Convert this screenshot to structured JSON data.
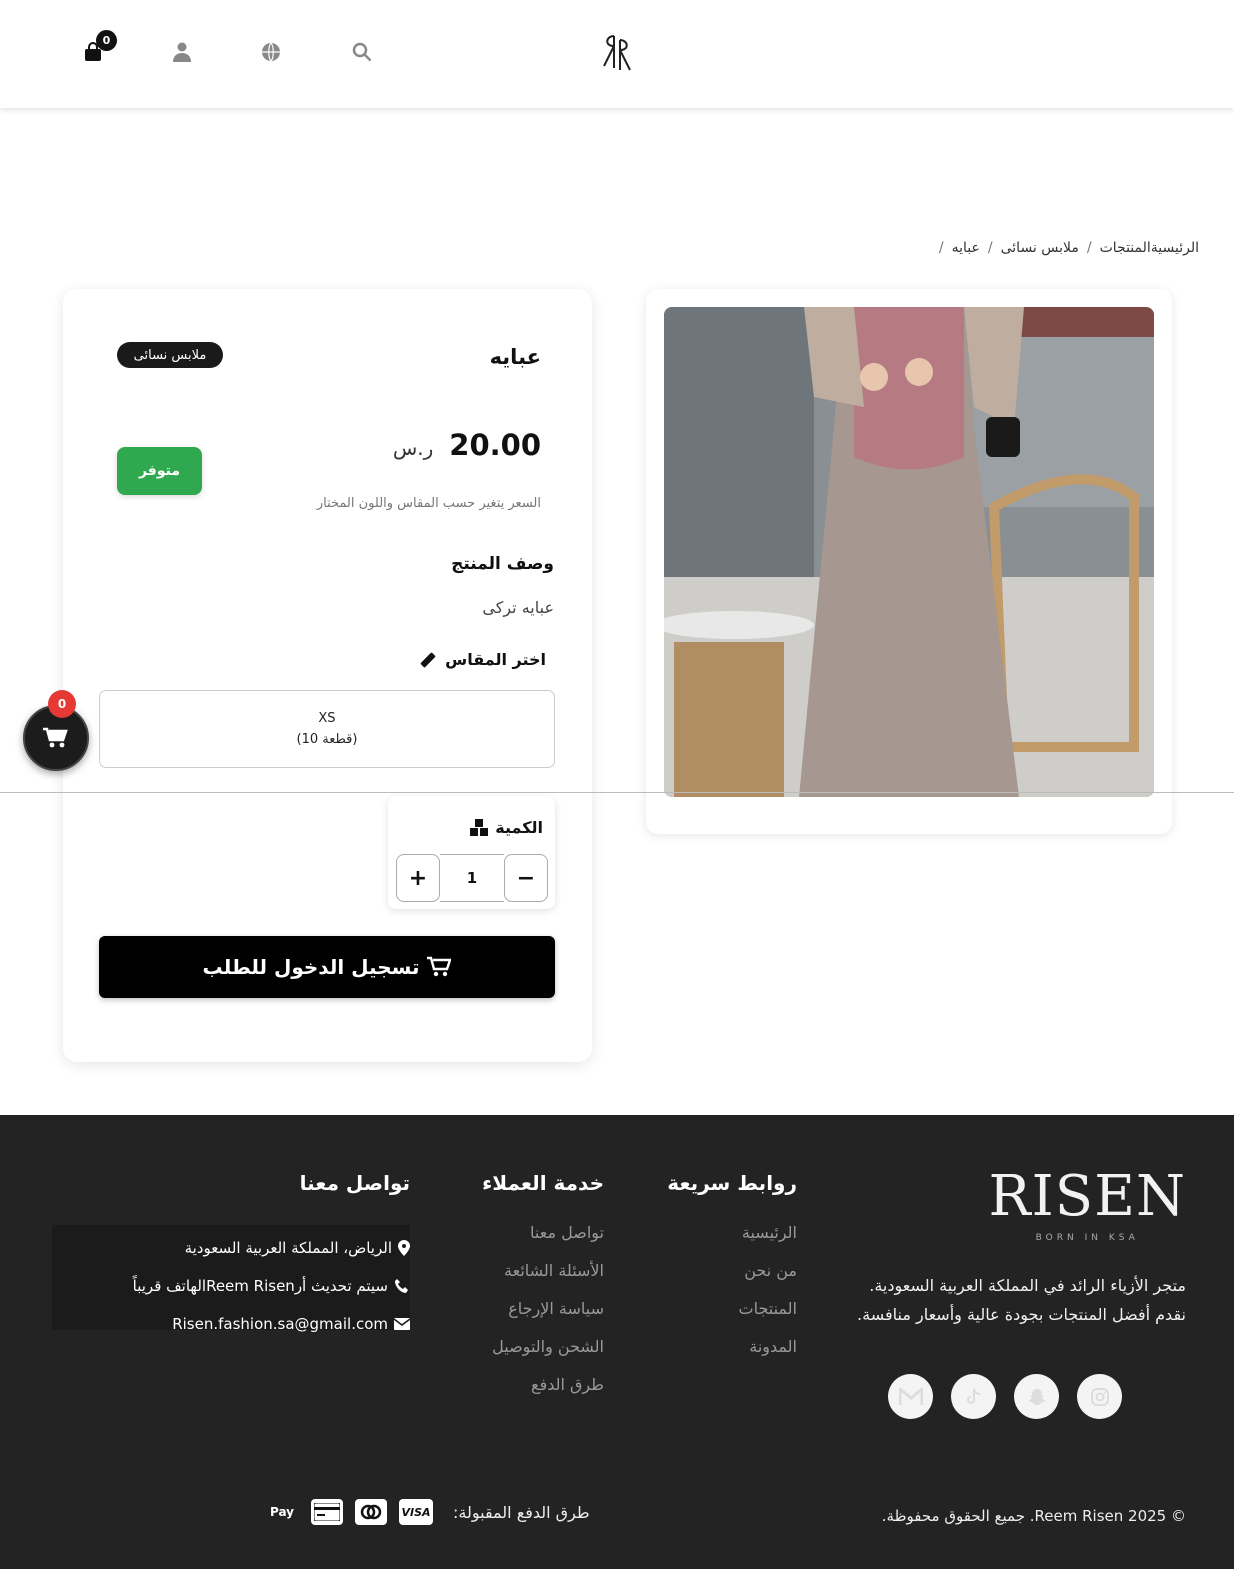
{
  "header": {
    "logo": "ꓤR",
    "cart_count": "0",
    "icons": [
      "cart-icon",
      "user-icon",
      "globe-icon",
      "search-icon"
    ]
  },
  "breadcrumb": {
    "items": [
      "الرئيسيةالمنتجات",
      "ملابس نسائى",
      "عبايه"
    ]
  },
  "product": {
    "title": "عبايه",
    "category": "ملابس نسائى",
    "price": "20.00",
    "currency": "ر.س",
    "stock": "متوفر",
    "price_note": "السعر يتغير حسب المقاس واللون المختار",
    "description_heading": "وصف المنتج",
    "description": "عبايه تركى",
    "size_heading": "اختر المقاس",
    "size_option": "XS",
    "size_stock": "(10 قطعة)",
    "qty_heading": "الكمية",
    "qty_value": "1",
    "qty_minus": "−",
    "qty_plus": "+",
    "login_button": "تسجيل الدخول للطلب"
  },
  "floating_cart": {
    "count": "0"
  },
  "footer": {
    "brand_name": "RISEN",
    "brand_tagline": "BORN IN KSA",
    "about": "متجر الأزياء الرائد في المملكة العربية السعودية. نقدم أفضل المنتجات بجودة عالية وأسعار منافسة.",
    "socials": [
      "instagram-icon",
      "snapchat-icon",
      "tiktok-icon",
      "mail-icon"
    ],
    "quick_links": {
      "heading": "روابط سريعة",
      "items": [
        "الرئيسية",
        "من نحن",
        "المنتجات",
        "المدونة"
      ]
    },
    "customer_service": {
      "heading": "خدمة العملاء",
      "items": [
        "تواصل معنا",
        "الأسئلة الشائعة",
        "سياسة الإرجاع",
        "الشحن والتوصيل",
        "طرق الدفع"
      ]
    },
    "contact": {
      "heading": "تواصل معنا",
      "address": "الرياض، المملكة العربية السعودية",
      "phone": "سيتم تحديث أرReem Risenالهاتف قريباً",
      "email": "Risen.fashion.sa@gmail.com"
    },
    "copyright": "© 2025 Reem Risen. جميع الحقوق محفوظة.",
    "payments_label": "طرق الدفع المقبولة:",
    "payment_methods": [
      "VISA",
      "mastercard",
      "card",
      "Pay"
    ]
  },
  "colors": {
    "stock_green": "#2fa84f",
    "footer_bg": "#232323",
    "badge_red": "#e53935",
    "primary_black": "#000000"
  }
}
